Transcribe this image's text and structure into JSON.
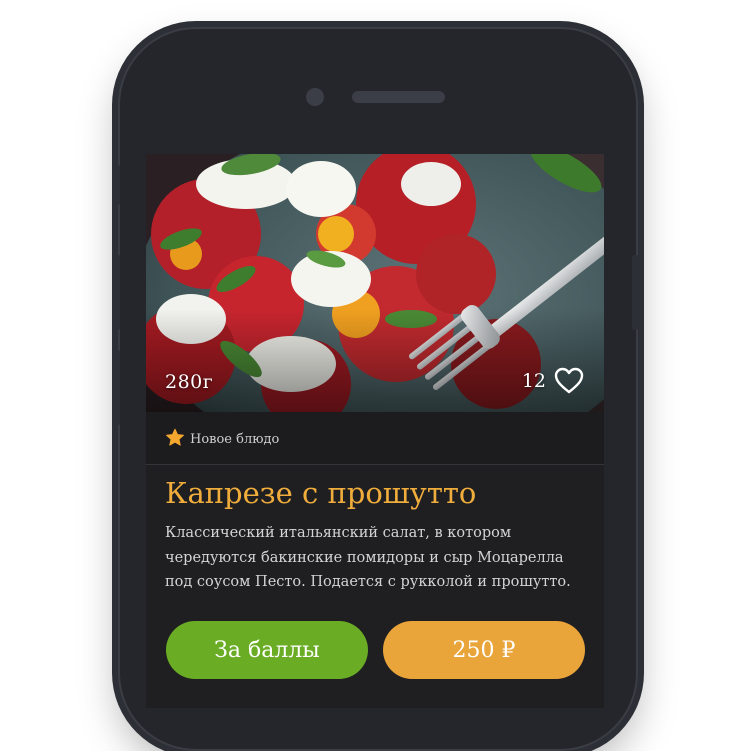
{
  "product": {
    "weight": "280г",
    "likes": "12",
    "badge": "Новое блюдо",
    "title": "Капрезе с прошутто",
    "description": "Классический итальянский салат, в котором чередуются бакинские помидоры и сыр Моцарелла под соусом Песто. Подается с рукколой и прошутто."
  },
  "actions": {
    "points_label": "За баллы",
    "price_label": "250 ₽"
  },
  "colors": {
    "accent": "#f0ad3c",
    "points_button": "#6aad25",
    "price_button": "#e9a43a",
    "background": "#1f1f22"
  },
  "icons": {
    "like": "heart-icon",
    "badge": "star-icon"
  }
}
